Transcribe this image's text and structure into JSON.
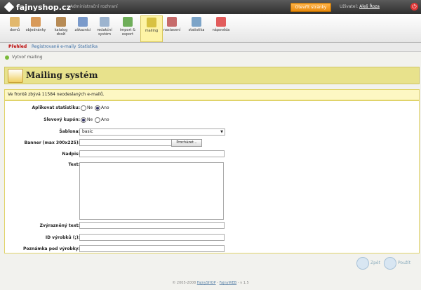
{
  "app": {
    "logo": "fajnyshop.cz",
    "admin_label": "Administrační rozhraní",
    "open_site": "Otevřít stránky",
    "user_label": "Uživatel:",
    "user_name": "Aleš Řoza"
  },
  "toolbar": [
    {
      "label": "domů",
      "icon": "home-icon",
      "color": "#e2b86d"
    },
    {
      "label": "objednávky",
      "icon": "orders-icon",
      "color": "#d89a5a"
    },
    {
      "label": "katalog zboží",
      "icon": "catalog-icon",
      "color": "#b78b55"
    },
    {
      "label": "zákazníci",
      "icon": "customers-icon",
      "color": "#7a9acb"
    },
    {
      "label": "redakční systém",
      "icon": "cms-icon",
      "color": "#9db4cf"
    },
    {
      "label": "import & export",
      "icon": "import-export-icon",
      "color": "#6fae5a"
    },
    {
      "label": "mailing",
      "icon": "mailing-icon",
      "color": "#d8c242",
      "active": true
    },
    {
      "label": "nastavení",
      "icon": "settings-icon",
      "color": "#c66b6b"
    },
    {
      "label": "statistika",
      "icon": "stats-icon",
      "color": "#7ca4c8"
    },
    {
      "label": "nápověda",
      "icon": "help-icon",
      "color": "#e25c5c"
    }
  ],
  "subnav": [
    "Přehled",
    "Registrované e-maily",
    "Statistika"
  ],
  "breadcrumb": "Vytvoř mailing",
  "page_title": "Mailing systém",
  "notice": "Ve frontě zbývá 11584 neodeslaných e-mailů.",
  "form": {
    "apply_stats_label": "Aplikovat statistiku:",
    "discount_coupon_label": "Slevový kupón:",
    "no": "Ne",
    "yes": "Ano",
    "template_label": "Šablona:",
    "template_value": "basic",
    "banner_label": "Banner (max 300x225):",
    "browse": "Procházet...",
    "heading_label": "Nadpis:",
    "text_label": "Text:",
    "highlight_label": "Zvýrazněný text:",
    "product_ids_label": "ID výrobků (;):",
    "note_label": "Poznámka pod výrobky:"
  },
  "actions": {
    "back": "Zpět",
    "use": "Použít"
  },
  "footer": {
    "prefix": "© 2005-2008",
    "shop": "FajnySHOP",
    "sep": "-",
    "web": "FajnyWEB",
    "version": "- v 1.5"
  }
}
